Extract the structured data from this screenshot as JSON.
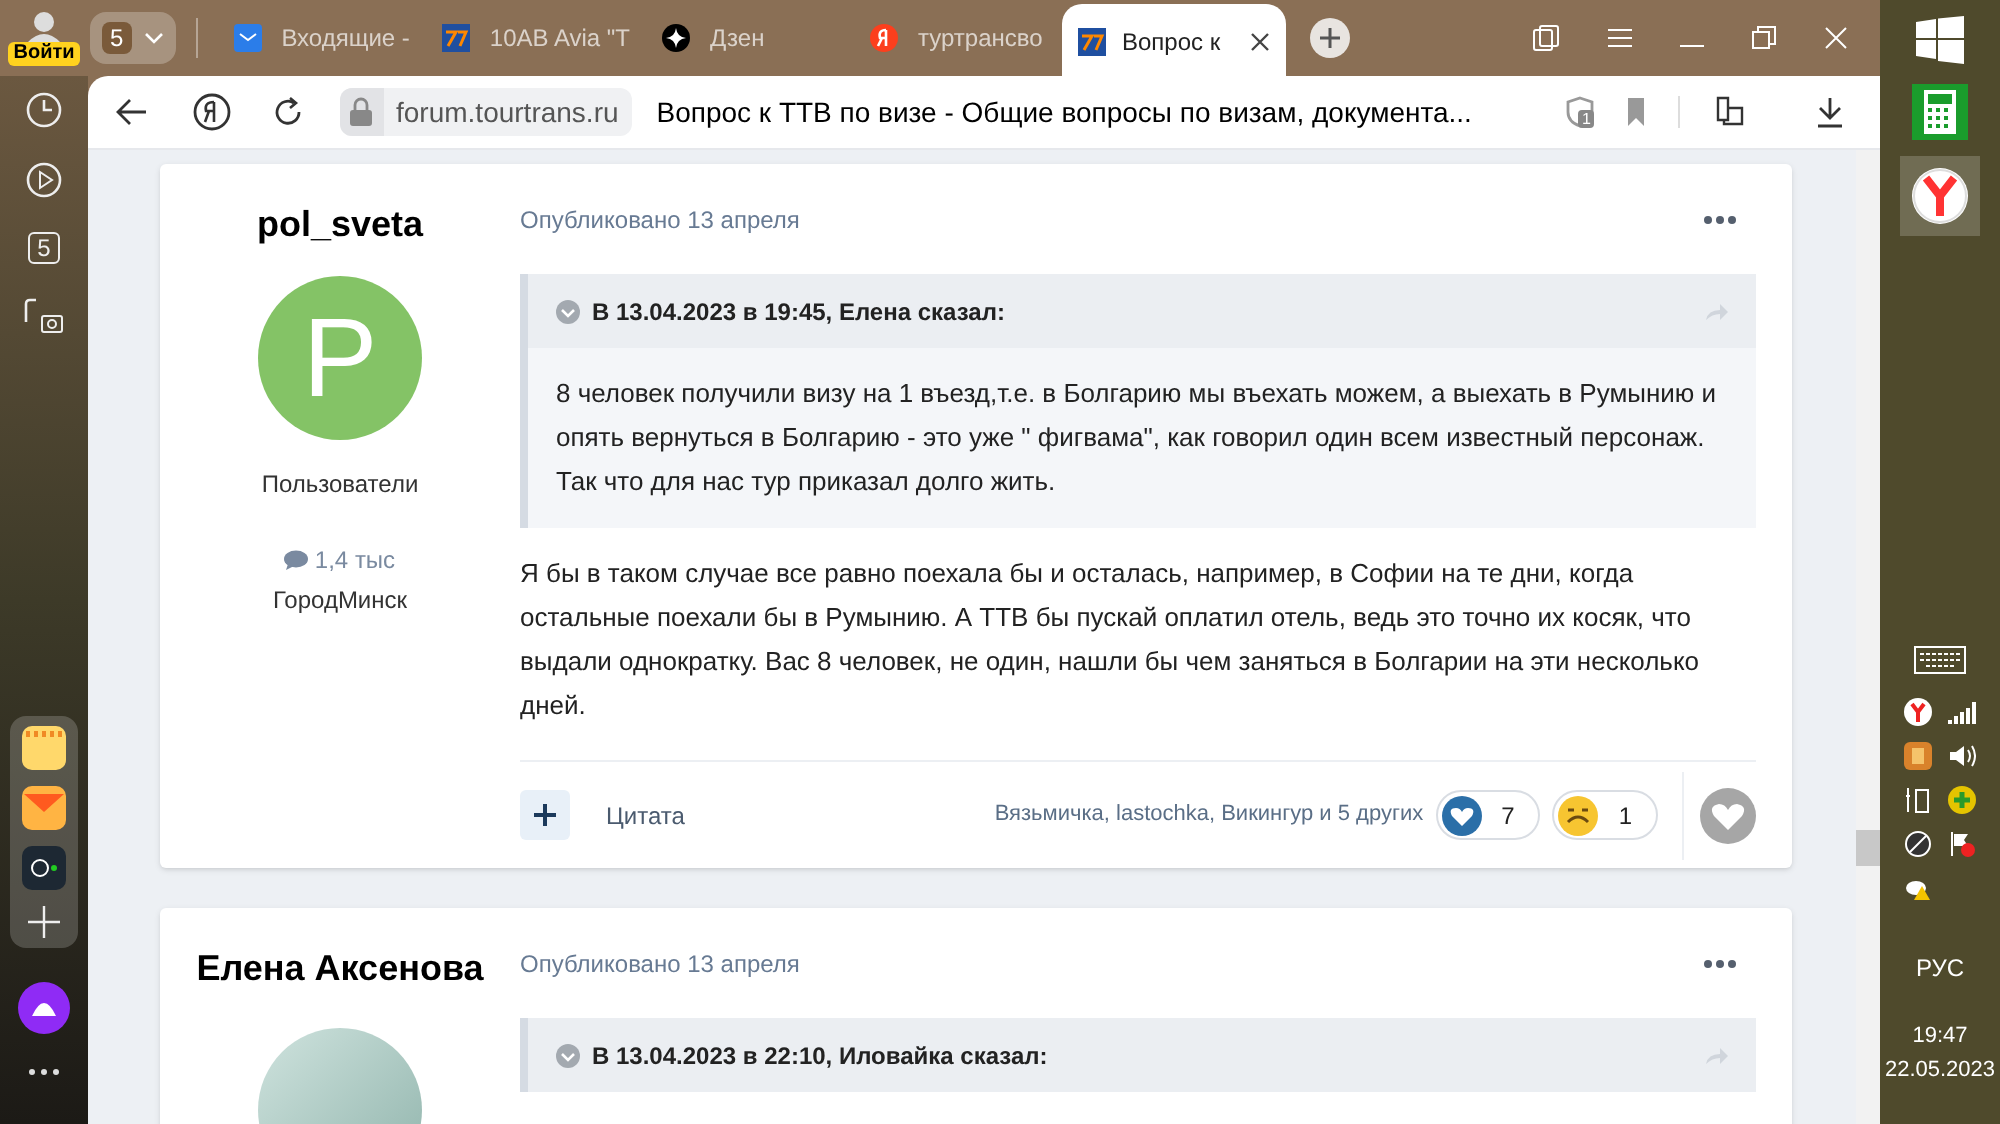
{
  "browser": {
    "profile_label": "Войти",
    "tab_group_count": "5",
    "tabs": [
      {
        "title": "Входящие -",
        "kind": "mail",
        "selected": false
      },
      {
        "title": "10AB Avia \"Т",
        "kind": "site",
        "selected": false
      },
      {
        "title": "Дзен",
        "kind": "zen",
        "selected": false
      },
      {
        "title": "туртрансво",
        "kind": "yandex",
        "selected": false
      },
      {
        "title": "Вопрос к",
        "kind": "site",
        "selected": true
      }
    ],
    "url": "forum.tourtrans.ru",
    "page_title": "Вопрос к ТТВ по визе - Общие вопросы по визам, документа...",
    "protect_badge": "1",
    "sidebar_badge": "5"
  },
  "posts": [
    {
      "author": "pol_sveta",
      "avatar": {
        "kind": "letter",
        "letter": "P"
      },
      "group": "Пользователи",
      "post_count": "1,4 тыс",
      "city": "ГородМинск",
      "published": "Опубликовано 13 апреля",
      "quote": {
        "header": "В 13.04.2023 в 19:45, Елена сказал:",
        "text": "8 человек получили визу на 1 въезд,т.е. в Болгарию мы въехать можем, а выехать в Румынию и опять вернуться в Болгарию - это уже \" фигвама\", как говорил один всем известный персонаж. Так что для нас тур приказал долго жить."
      },
      "body": "Я бы в таком случае все равно поехала бы и осталась, например, в Софии на те дни, когда остальные поехали бы в Румынию. А ТТВ бы пускай оплатил отель, ведь это точно их косяк, что выдали однократку. Вас 8 человек, не один, нашли бы чем заняться в Болгарии на эти несколько дней.",
      "quote_label": "Цитата",
      "reactors": "Вязьмичка, lastochka, Викингур и 5 других",
      "reactions": [
        {
          "kind": "heart",
          "count": "7"
        },
        {
          "kind": "sad",
          "count": "1"
        }
      ]
    },
    {
      "author": "Елена Аксенова",
      "avatar": {
        "kind": "photo"
      },
      "published": "Опубликовано 13 апреля",
      "quote": {
        "header": "В 13.04.2023 в 22:10, Иловайка сказал:"
      }
    }
  ],
  "taskbar": {
    "language": "РУС",
    "time": "19:47",
    "date": "22.05.2023"
  }
}
